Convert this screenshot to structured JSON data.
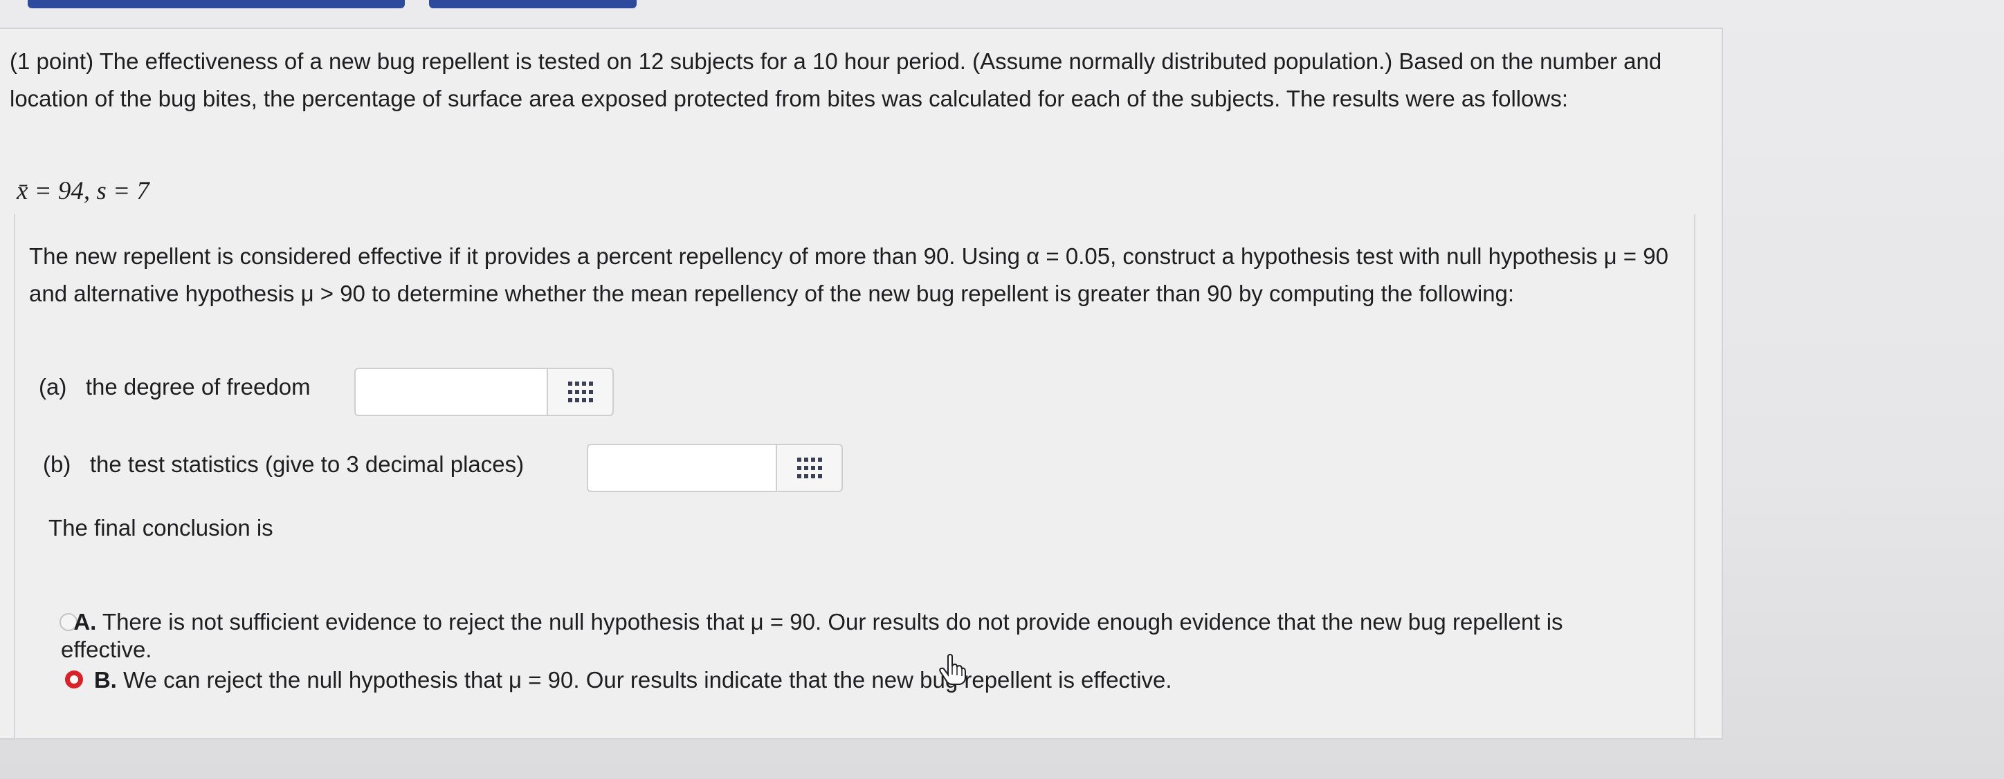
{
  "problem": {
    "intro": "(1 point) The effectiveness of a new bug repellent is tested on 12 subjects for a 10 hour period. (Assume normally distributed population.) Based on the number and location of the bug bites, the percentage of surface area exposed protected from bites was calculated for each of the subjects. The results were as follows:",
    "stats": "x̄ = 94, s = 7",
    "description_part1": "The new repellent is considered effective if it provides a percent repellency of more than 90. Using α = 0.05, construct a hypothesis test with null hypothesis μ = 90 and alternative hypothesis μ > 90 to determine whether the mean repellency of the new bug repellent is greater than 90 by computing the following:"
  },
  "questions": {
    "a_label": "(a)",
    "a_text": "the degree of freedom",
    "a_value": "",
    "b_label": "(b)",
    "b_text": "the test statistics (give to 3 decimal places)",
    "b_value": ""
  },
  "conclusion": {
    "heading": "The final conclusion is",
    "option_a_letter": "A.",
    "option_a_text": "There is not sufficient evidence to reject the null hypothesis that μ = 90. Our results do not provide enough evidence that the new bug repellent is",
    "option_a_text_cont": "effective.",
    "option_b_letter": "B.",
    "option_b_text": "We can reject the null hypothesis that μ = 90. Our results indicate that the new bug repellent is effective.",
    "selected": "B"
  },
  "icons": {
    "grid": "grid-icon",
    "cursor": "hand-cursor-icon"
  },
  "colors": {
    "selected_radio": "#d8232a",
    "top_tab": "#2e4a9c"
  }
}
